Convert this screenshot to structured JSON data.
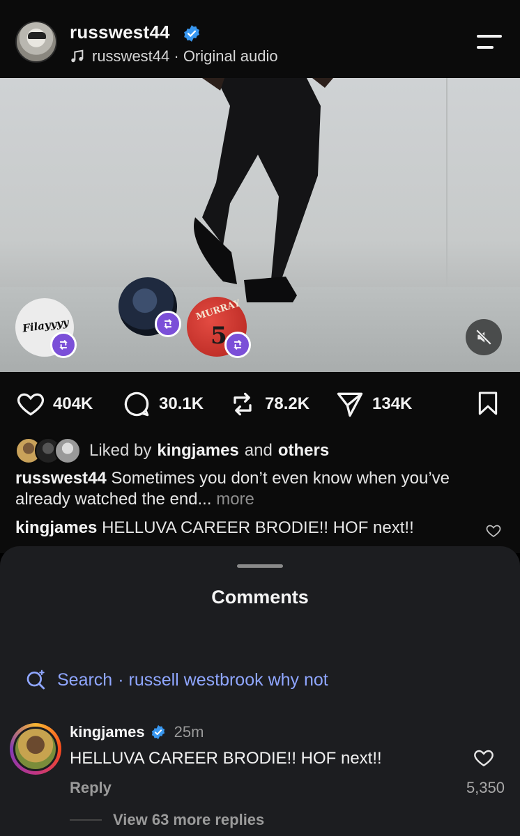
{
  "header": {
    "username": "russwest44",
    "audio": "russwest44 · Original audio",
    "icons": [
      "verified-badge-icon",
      "music-note-icon",
      "menu-icon"
    ]
  },
  "media": {
    "stickers": [
      {
        "label": "Filayyyy"
      },
      {
        "label": ""
      },
      {
        "label": "MURRAY",
        "number": "5"
      }
    ],
    "icons": [
      "repost-icon",
      "mute-icon"
    ]
  },
  "actions": {
    "likes": "404K",
    "comments": "30.1K",
    "reposts": "78.2K",
    "shares": "134K",
    "icons": [
      "heart-icon",
      "comment-icon",
      "repost-icon",
      "share-icon",
      "bookmark-icon"
    ]
  },
  "liked_by": {
    "prefix": "Liked by",
    "user": "kingjames",
    "and": "and",
    "others": "others"
  },
  "caption": {
    "user": "russwest44",
    "text": "Sometimes you don’t even know when you’ve already watched the end...",
    "more": "more"
  },
  "top_comment": {
    "user": "kingjames",
    "text": "HELLUVA CAREER BRODIE!! HOF next!!"
  },
  "comments_sheet": {
    "title": "Comments",
    "search_prefix": "Search",
    "search_query": "· russell westbrook why not",
    "comment": {
      "user": "kingjames",
      "time": "25m",
      "text": "HELLUVA CAREER BRODIE!! HOF next!!",
      "reply": "Reply",
      "likes": "5,350",
      "view_replies": "View 63 more replies"
    }
  },
  "colors": {
    "background": "#0b0b0b",
    "sheet": "#1c1d20",
    "accent_blue": "#8fa6ff",
    "verified_blue": "#3897f0",
    "repost_purple": "#7b4fd8"
  }
}
